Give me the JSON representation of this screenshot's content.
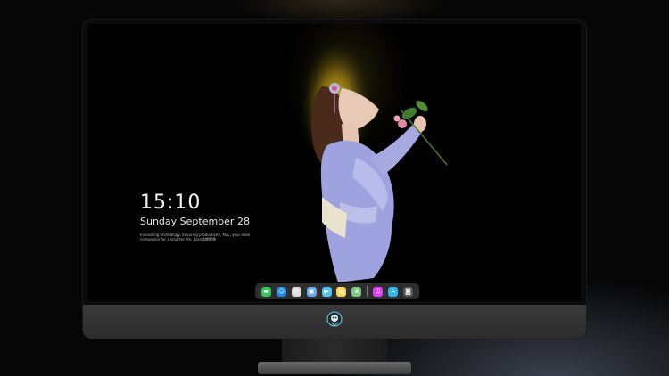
{
  "lock_screen": {
    "time": "15:10",
    "date": "Sunday September 28",
    "tagline": "Innovating technology, Ensuring productivity, Mac, your ideal companion for a smarter life. Bass組織團隊"
  },
  "dock": {
    "apps": [
      {
        "name": "Messages",
        "icon": "messages-icon",
        "color": "#34c759",
        "glyph": "▬"
      },
      {
        "name": "Finder",
        "icon": "finder-icon",
        "color": "#1e88e5",
        "glyph": "☺"
      },
      {
        "name": "Safari",
        "icon": "safari-icon",
        "color": "#d9d9d9",
        "glyph": "◎"
      },
      {
        "name": "Preview",
        "icon": "preview-icon",
        "color": "#6aa9e9",
        "glyph": "▣"
      },
      {
        "name": "Final Cut",
        "icon": "clapper-icon",
        "color": "#4fc3f7",
        "glyph": "▶"
      },
      {
        "name": "Notes",
        "icon": "notes-icon",
        "color": "#ffd54f",
        "glyph": "▤"
      },
      {
        "name": "Photos",
        "icon": "photos-icon",
        "color": "#81c784",
        "glyph": "❀"
      },
      {
        "name": "Music",
        "icon": "music-icon",
        "color": "#e040fb",
        "glyph": "♫"
      },
      {
        "name": "App Store",
        "icon": "app-store-icon",
        "color": "#29b6f6",
        "glyph": "A"
      },
      {
        "name": "Camera",
        "icon": "camera-icon",
        "color": "#555555",
        "glyph": "◙"
      }
    ]
  },
  "colors": {
    "screen_background": "#000000",
    "halo": "#e8c21a",
    "kimono": "#9ea3df"
  }
}
